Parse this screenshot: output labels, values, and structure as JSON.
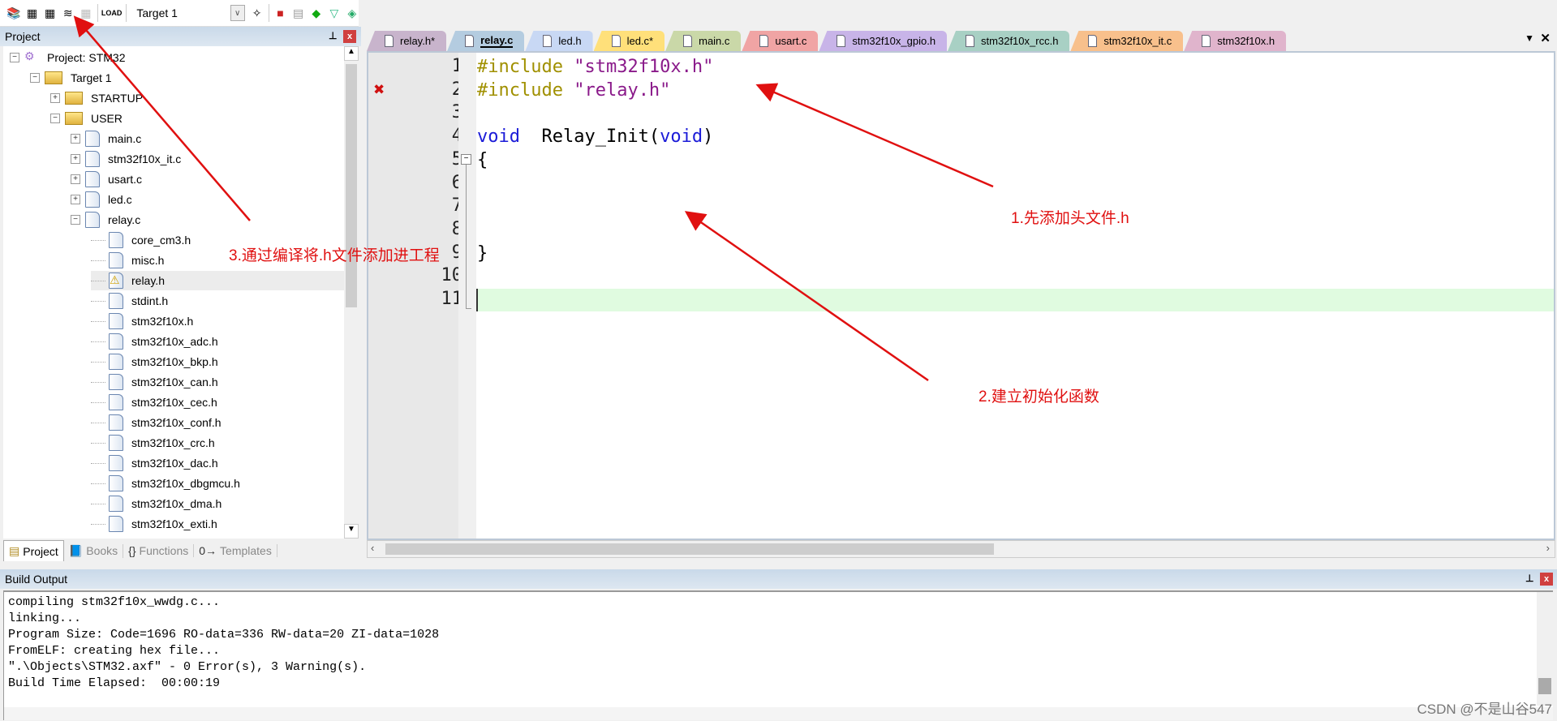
{
  "toolbar": {
    "buttons": [
      "translate-icon",
      "build-icon",
      "rebuild-icon",
      "batch-build-icon",
      "stop-build-icon",
      "load-icon"
    ],
    "target": "Target 1",
    "right_buttons": [
      "options-wand-icon",
      "manage-components-icon",
      "window-icon",
      "diamond-icon",
      "filter-icon",
      "packs-icon"
    ]
  },
  "project_panel": {
    "title": "Project",
    "tree": [
      {
        "label": "Project: STM32",
        "level": 0,
        "exp": "−",
        "icon": "project"
      },
      {
        "label": "Target 1",
        "level": 1,
        "exp": "−",
        "icon": "target"
      },
      {
        "label": "STARTUP",
        "level": 2,
        "exp": "+",
        "icon": "folder"
      },
      {
        "label": "USER",
        "level": 2,
        "exp": "−",
        "icon": "folder"
      },
      {
        "label": "main.c",
        "level": 3,
        "exp": "+",
        "icon": "file"
      },
      {
        "label": "stm32f10x_it.c",
        "level": 3,
        "exp": "+",
        "icon": "file"
      },
      {
        "label": "usart.c",
        "level": 3,
        "exp": "+",
        "icon": "file"
      },
      {
        "label": "led.c",
        "level": 3,
        "exp": "+",
        "icon": "file"
      },
      {
        "label": "relay.c",
        "level": 3,
        "exp": "−",
        "icon": "file"
      },
      {
        "label": "core_cm3.h",
        "level": 4,
        "icon": "file"
      },
      {
        "label": "misc.h",
        "level": 4,
        "icon": "file"
      },
      {
        "label": "relay.h",
        "level": 4,
        "icon": "warning",
        "selected": true
      },
      {
        "label": "stdint.h",
        "level": 4,
        "icon": "file"
      },
      {
        "label": "stm32f10x.h",
        "level": 4,
        "icon": "file"
      },
      {
        "label": "stm32f10x_adc.h",
        "level": 4,
        "icon": "file"
      },
      {
        "label": "stm32f10x_bkp.h",
        "level": 4,
        "icon": "file"
      },
      {
        "label": "stm32f10x_can.h",
        "level": 4,
        "icon": "file"
      },
      {
        "label": "stm32f10x_cec.h",
        "level": 4,
        "icon": "file"
      },
      {
        "label": "stm32f10x_conf.h",
        "level": 4,
        "icon": "file"
      },
      {
        "label": "stm32f10x_crc.h",
        "level": 4,
        "icon": "file"
      },
      {
        "label": "stm32f10x_dac.h",
        "level": 4,
        "icon": "file"
      },
      {
        "label": "stm32f10x_dbgmcu.h",
        "level": 4,
        "icon": "file"
      },
      {
        "label": "stm32f10x_dma.h",
        "level": 4,
        "icon": "file"
      },
      {
        "label": "stm32f10x_exti.h",
        "level": 4,
        "icon": "file"
      }
    ],
    "bottom_tabs": [
      {
        "label": "Project",
        "icon": "project-icon"
      },
      {
        "label": "Books",
        "icon": "books-icon"
      },
      {
        "label": "Functions",
        "icon": "{}"
      },
      {
        "label": "Templates",
        "icon": "0→"
      }
    ]
  },
  "editor": {
    "tabs": [
      {
        "label": "relay.h*",
        "color": "#c8b4cc"
      },
      {
        "label": "relay.c",
        "color": "#b4cce0",
        "active": true
      },
      {
        "label": "led.h",
        "color": "#c8d8f4"
      },
      {
        "label": "led.c*",
        "color": "#ffe07a"
      },
      {
        "label": "main.c",
        "color": "#cad8a8"
      },
      {
        "label": "usart.c",
        "color": "#f0a4a4"
      },
      {
        "label": "stm32f10x_gpio.h",
        "color": "#c8b4e8"
      },
      {
        "label": "stm32f10x_rcc.h",
        "color": "#a8d0c4"
      },
      {
        "label": "stm32f10x_it.c",
        "color": "#f8c08c"
      },
      {
        "label": "stm32f10x.h",
        "color": "#e0b4cc"
      }
    ],
    "lines": [
      {
        "n": "1",
        "html": [
          [
            "pp",
            "#include "
          ],
          [
            "st",
            "\"stm32f10x.h\""
          ]
        ]
      },
      {
        "n": "2",
        "html": [
          [
            "pp",
            "#include "
          ],
          [
            "st",
            "\"relay.h\""
          ]
        ],
        "error": true
      },
      {
        "n": "3",
        "html": []
      },
      {
        "n": "4",
        "html": [
          [
            "kw",
            "void"
          ],
          [
            "",
            "  Relay_Init("
          ],
          [
            "kw",
            "void"
          ],
          [
            "",
            ")"
          ]
        ]
      },
      {
        "n": "5",
        "html": [
          [
            "",
            "{"
          ]
        ]
      },
      {
        "n": "6",
        "html": []
      },
      {
        "n": "7",
        "html": []
      },
      {
        "n": "8",
        "html": []
      },
      {
        "n": "9",
        "html": [
          [
            "",
            "}"
          ]
        ]
      },
      {
        "n": "10",
        "html": []
      },
      {
        "n": "11",
        "html": [],
        "current": true
      }
    ]
  },
  "build_output": {
    "title": "Build Output",
    "lines": [
      "compiling stm32f10x_wwdg.c...",
      "linking...",
      "Program Size: Code=1696 RO-data=336 RW-data=20 ZI-data=1028",
      "FromELF: creating hex file...",
      "\".\\Objects\\STM32.axf\" - 0 Error(s), 3 Warning(s).",
      "Build Time Elapsed:  00:00:19"
    ]
  },
  "annotations": {
    "a1": "1.先添加头文件.h",
    "a2": "2.建立初始化函数",
    "a3": "3.通过编译将.h文件添加进工程"
  },
  "watermark": "CSDN @不是山谷547",
  "colors": {
    "annotation": "#e01010",
    "current_line": "#e0fbe0"
  }
}
